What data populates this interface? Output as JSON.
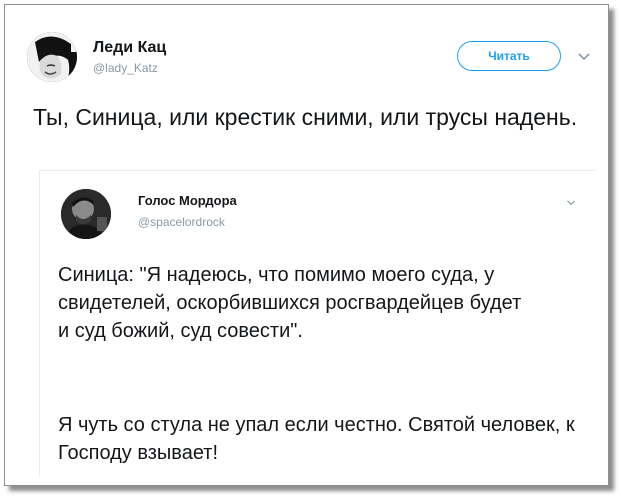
{
  "tweet": {
    "author_name": "Леди Кац",
    "author_handle": "@lady_Katz",
    "follow_label": "Читать",
    "text": "Ты, Синица, или крестик сними, или трусы надень."
  },
  "quoted_tweet": {
    "author_name": "Голос Мордора",
    "author_handle": "@spacelordrock",
    "paragraphs": [
      "Синица: \"Я надеюсь, что помимо моего суда, у свидетелей, оскорбившихся росгвардейцев будет и суд божий, суд совести\".",
      "Я чуть со стула не упал если честно. Святой человек, к Господу взывает!"
    ]
  },
  "icons": {
    "menu": "chevron-down-icon",
    "quoted_menu": "chevron-down-icon"
  },
  "colors": {
    "accent": "#1da1f2",
    "secondary_text": "#8899a6",
    "primary_text": "#14171a"
  }
}
